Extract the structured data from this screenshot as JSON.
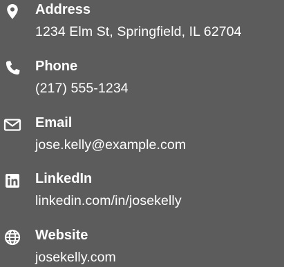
{
  "contact": {
    "items": [
      {
        "icon": "map-marker-icon",
        "label": "Address",
        "value": "1234 Elm St, Springfield, IL 62704"
      },
      {
        "icon": "phone-icon",
        "label": "Phone",
        "value": "(217) 555-1234"
      },
      {
        "icon": "envelope-icon",
        "label": "Email",
        "value": "jose.kelly@example.com"
      },
      {
        "icon": "linkedin-icon",
        "label": "LinkedIn",
        "value": "linkedin.com/in/josekelly"
      },
      {
        "icon": "globe-icon",
        "label": "Website",
        "value": "josekelly.com"
      }
    ]
  },
  "colors": {
    "background": "#5c5c5c",
    "text": "#ffffff"
  }
}
